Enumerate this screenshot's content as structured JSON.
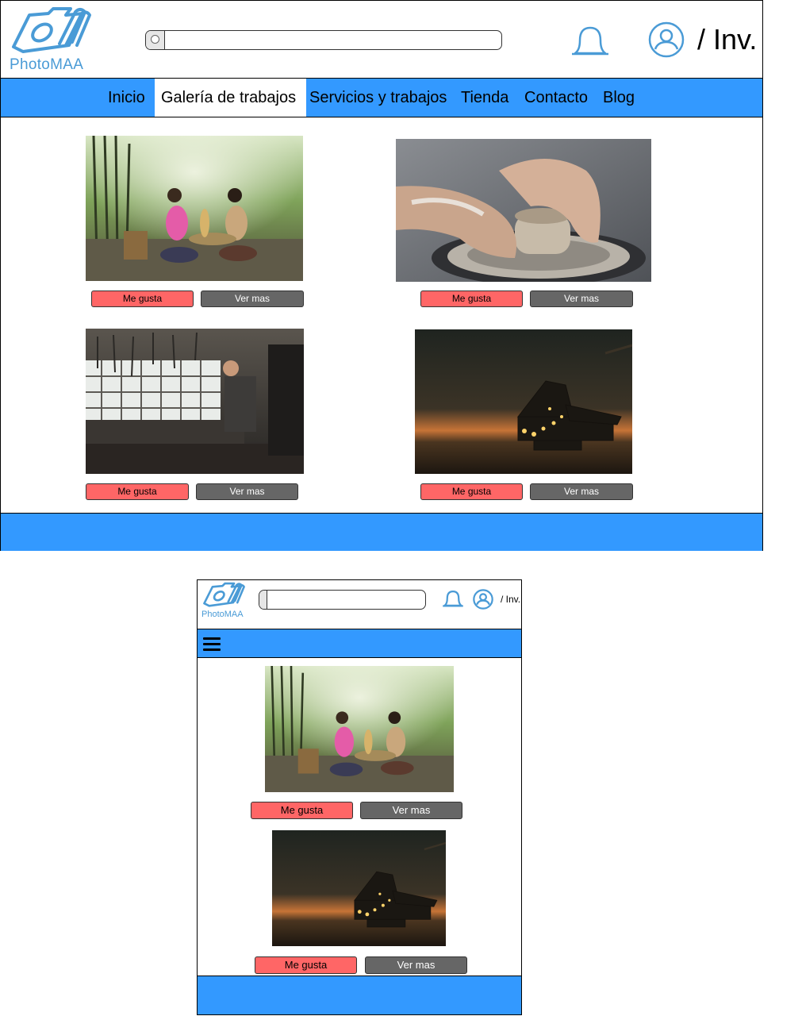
{
  "brand": {
    "name": "PhotoMAA"
  },
  "header": {
    "guest_label": "/ Inv."
  },
  "nav": {
    "items": [
      {
        "label": "Inicio"
      },
      {
        "label": "Galería de trabajos"
      },
      {
        "label": "Servicios y trabajos"
      },
      {
        "label": "Tienda"
      },
      {
        "label": "Contacto"
      },
      {
        "label": "Blog"
      }
    ],
    "active_index": 1
  },
  "gallery": {
    "like_label": "Me gusta",
    "more_label": "Ver mas",
    "photos": [
      {
        "subject": "two women sifting grain in bamboo forest"
      },
      {
        "subject": "hands shaping clay on pottery wheel"
      },
      {
        "subject": "blacksmith in workshop"
      },
      {
        "subject": "bucket wheel excavator at dusk"
      }
    ]
  },
  "mobile": {
    "menu_icon": "hamburger-menu-icon",
    "photos_shown": [
      0,
      3
    ]
  },
  "colors": {
    "nav_blue": "#3399ff",
    "like_red": "#ff6666",
    "more_gray": "#666666",
    "logo_blue": "#4a9bd6"
  },
  "icons": [
    "camera-logo-icon",
    "search-icon",
    "bell-icon",
    "user-icon",
    "hamburger-menu-icon"
  ]
}
